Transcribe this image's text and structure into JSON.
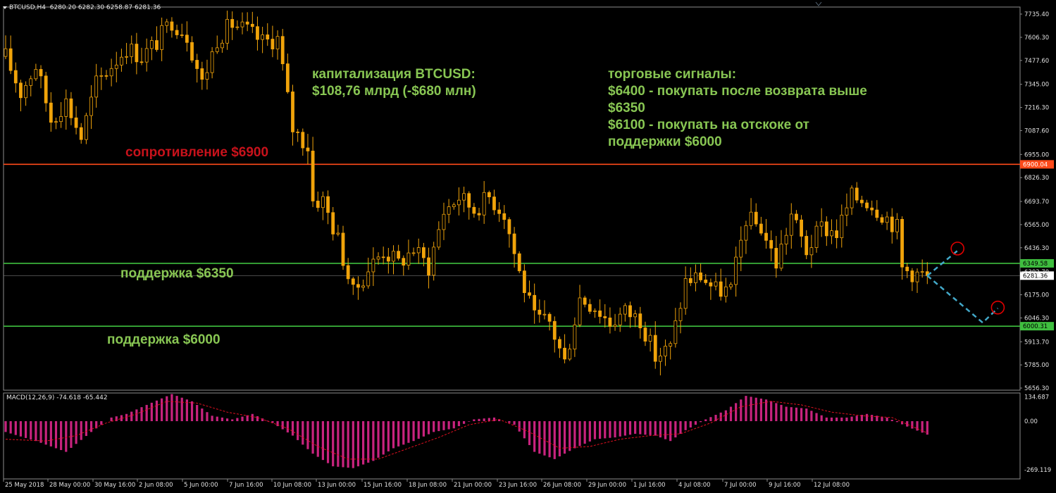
{
  "header": {
    "symbol": "BTCUSD,H4",
    "ohlc": "6280.20 6282.30 6258.87 6281.36"
  },
  "annotations": {
    "cap_line1": "капитализация BTCUSD:",
    "cap_line2": "$108,76 млрд (-$680 млн)",
    "signals_l1": "торговые сигналы:",
    "signals_l2": "$6400 - покупать после возврата выше",
    "signals_l3": "$6350",
    "signals_l4": "$6100 - покупать на отскоке от",
    "signals_l5": "поддержки $6000",
    "resistance": "сопротивление $6900",
    "support1": "поддержка $6350",
    "support2": "поддержка $6000"
  },
  "colors": {
    "candle": "#f0a30a",
    "resistance_line": "#ff4a1a",
    "support_line": "#3fbf3f",
    "annotation_green": "#88c653",
    "annotation_red": "#c8121b",
    "macd_hist": "#c8237e",
    "macd_signal": "#e01020",
    "forecast": "#42a8c8",
    "marker": "#e00000"
  },
  "chart_data": [
    {
      "type": "candlestick",
      "symbol": "BTCUSD",
      "timeframe": "H4",
      "ylim": [
        5656.3,
        7735.4
      ],
      "y_ticks": [
        "7735.40",
        "7606.30",
        "7477.60",
        "7345.00",
        "7216.30",
        "7087.60",
        "6955.00",
        "6826.30",
        "6693.70",
        "6565.00",
        "6436.30",
        "6302.70",
        "6175.00",
        "6046.30",
        "5913.70",
        "5785.00",
        "5656.30"
      ],
      "x_ticks": [
        "25 May 2018",
        "28 May 00:00",
        "30 May 16:00",
        "2 Jun 08:00",
        "5 Jun 00:00",
        "7 Jun 16:00",
        "10 Jun 08:00",
        "13 Jun 00:00",
        "15 Jun 16:00",
        "18 Jun 08:00",
        "21 Jun 00:00",
        "23 Jun 16:00",
        "26 Jun 08:00",
        "29 Jun 00:00",
        "1 Jul 16:00",
        "4 Jul 08:00",
        "7 Jul 00:00",
        "9 Jul 16:00",
        "12 Jul 08:00"
      ],
      "price_path": [
        [
          0,
          7500
        ],
        [
          3,
          7300
        ],
        [
          6,
          7450
        ],
        [
          9,
          7150
        ],
        [
          12,
          7250
        ],
        [
          15,
          7050
        ],
        [
          18,
          7350
        ],
        [
          21,
          7450
        ],
        [
          24,
          7550
        ],
        [
          27,
          7500
        ],
        [
          30,
          7580
        ],
        [
          33,
          7700
        ],
        [
          36,
          7620
        ],
        [
          39,
          7350
        ],
        [
          42,
          7600
        ],
        [
          45,
          7680
        ],
        [
          48,
          7640
        ],
        [
          51,
          7580
        ],
        [
          54,
          7600
        ],
        [
          57,
          7100
        ],
        [
          60,
          7000
        ],
        [
          61,
          6700
        ],
        [
          63,
          6700
        ],
        [
          66,
          6480
        ],
        [
          69,
          6180
        ],
        [
          72,
          6320
        ],
        [
          75,
          6420
        ],
        [
          78,
          6350
        ],
        [
          81,
          6430
        ],
        [
          84,
          6330
        ],
        [
          87,
          6640
        ],
        [
          90,
          6720
        ],
        [
          93,
          6650
        ],
        [
          96,
          6720
        ],
        [
          99,
          6630
        ],
        [
          102,
          6300
        ],
        [
          105,
          6040
        ],
        [
          108,
          6020
        ],
        [
          111,
          5800
        ],
        [
          114,
          6160
        ],
        [
          117,
          6110
        ],
        [
          120,
          6020
        ],
        [
          123,
          6080
        ],
        [
          126,
          6040
        ],
        [
          129,
          5830
        ],
        [
          132,
          5880
        ],
        [
          135,
          6250
        ],
        [
          138,
          6280
        ],
        [
          141,
          6200
        ],
        [
          144,
          6200
        ],
        [
          147,
          6600
        ],
        [
          150,
          6550
        ],
        [
          153,
          6350
        ],
        [
          156,
          6620
        ],
        [
          159,
          6420
        ],
        [
          162,
          6550
        ],
        [
          165,
          6520
        ],
        [
          168,
          6720
        ],
        [
          171,
          6700
        ],
        [
          174,
          6630
        ],
        [
          177,
          6550
        ],
        [
          178,
          6320
        ],
        [
          181,
          6290
        ],
        [
          183,
          6281.36
        ]
      ],
      "horizontal_levels": [
        {
          "price": 6900.04,
          "label": "6900.04",
          "color": "#ff4a1a"
        },
        {
          "price": 6349.58,
          "label": "6349.58",
          "color": "#3fbf3f"
        },
        {
          "price": 6000.31,
          "label": "6000.31",
          "color": "#3fbf3f"
        }
      ],
      "current_price_label": "6281.36",
      "forecast_paths": [
        {
          "points": [
            [
              183,
              6281
            ],
            [
              189,
              6420
            ]
          ],
          "style": "dashed"
        },
        {
          "points": [
            [
              183,
              6281
            ],
            [
              194,
              6020
            ],
            [
              197,
              6100
            ]
          ],
          "style": "dashed"
        }
      ],
      "markers": [
        {
          "x": 189,
          "price": 6432
        },
        {
          "x": 197,
          "price": 6104
        }
      ]
    },
    {
      "type": "bar",
      "title": "MACD(12,26,9) -74.618 -65.442",
      "ylim": [
        -269.119,
        134.687
      ],
      "y_ticks": [
        "134.687",
        "0.00",
        "-269.119"
      ],
      "macd_path": [
        [
          0,
          -60
        ],
        [
          6,
          -110
        ],
        [
          12,
          -170
        ],
        [
          17,
          -60
        ],
        [
          21,
          20
        ],
        [
          24,
          40
        ],
        [
          28,
          90
        ],
        [
          33,
          150
        ],
        [
          37,
          110
        ],
        [
          41,
          30
        ],
        [
          45,
          10
        ],
        [
          49,
          40
        ],
        [
          53,
          -10
        ],
        [
          57,
          -80
        ],
        [
          61,
          -180
        ],
        [
          65,
          -250
        ],
        [
          69,
          -260
        ],
        [
          73,
          -220
        ],
        [
          77,
          -150
        ],
        [
          81,
          -110
        ],
        [
          85,
          -60
        ],
        [
          89,
          -40
        ],
        [
          93,
          10
        ],
        [
          97,
          20
        ],
        [
          101,
          -20
        ],
        [
          105,
          -170
        ],
        [
          109,
          -210
        ],
        [
          113,
          -150
        ],
        [
          117,
          -100
        ],
        [
          121,
          -90
        ],
        [
          125,
          -70
        ],
        [
          129,
          -80
        ],
        [
          132,
          -110
        ],
        [
          135,
          -50
        ],
        [
          139,
          10
        ],
        [
          143,
          60
        ],
        [
          147,
          140
        ],
        [
          151,
          120
        ],
        [
          155,
          80
        ],
        [
          159,
          70
        ],
        [
          163,
          20
        ],
        [
          167,
          20
        ],
        [
          171,
          40
        ],
        [
          175,
          20
        ],
        [
          179,
          -30
        ],
        [
          183,
          -74.618
        ]
      ],
      "signal_path": [
        [
          0,
          -100
        ],
        [
          8,
          -110
        ],
        [
          14,
          -80
        ],
        [
          20,
          -10
        ],
        [
          26,
          40
        ],
        [
          32,
          110
        ],
        [
          38,
          100
        ],
        [
          44,
          50
        ],
        [
          50,
          20
        ],
        [
          56,
          -40
        ],
        [
          62,
          -140
        ],
        [
          68,
          -210
        ],
        [
          74,
          -210
        ],
        [
          80,
          -150
        ],
        [
          86,
          -90
        ],
        [
          92,
          -20
        ],
        [
          98,
          10
        ],
        [
          104,
          -60
        ],
        [
          110,
          -150
        ],
        [
          116,
          -140
        ],
        [
          122,
          -100
        ],
        [
          128,
          -80
        ],
        [
          134,
          -70
        ],
        [
          140,
          -10
        ],
        [
          146,
          80
        ],
        [
          152,
          110
        ],
        [
          158,
          90
        ],
        [
          164,
          50
        ],
        [
          170,
          30
        ],
        [
          176,
          20
        ],
        [
          183,
          -65.442
        ]
      ]
    }
  ]
}
